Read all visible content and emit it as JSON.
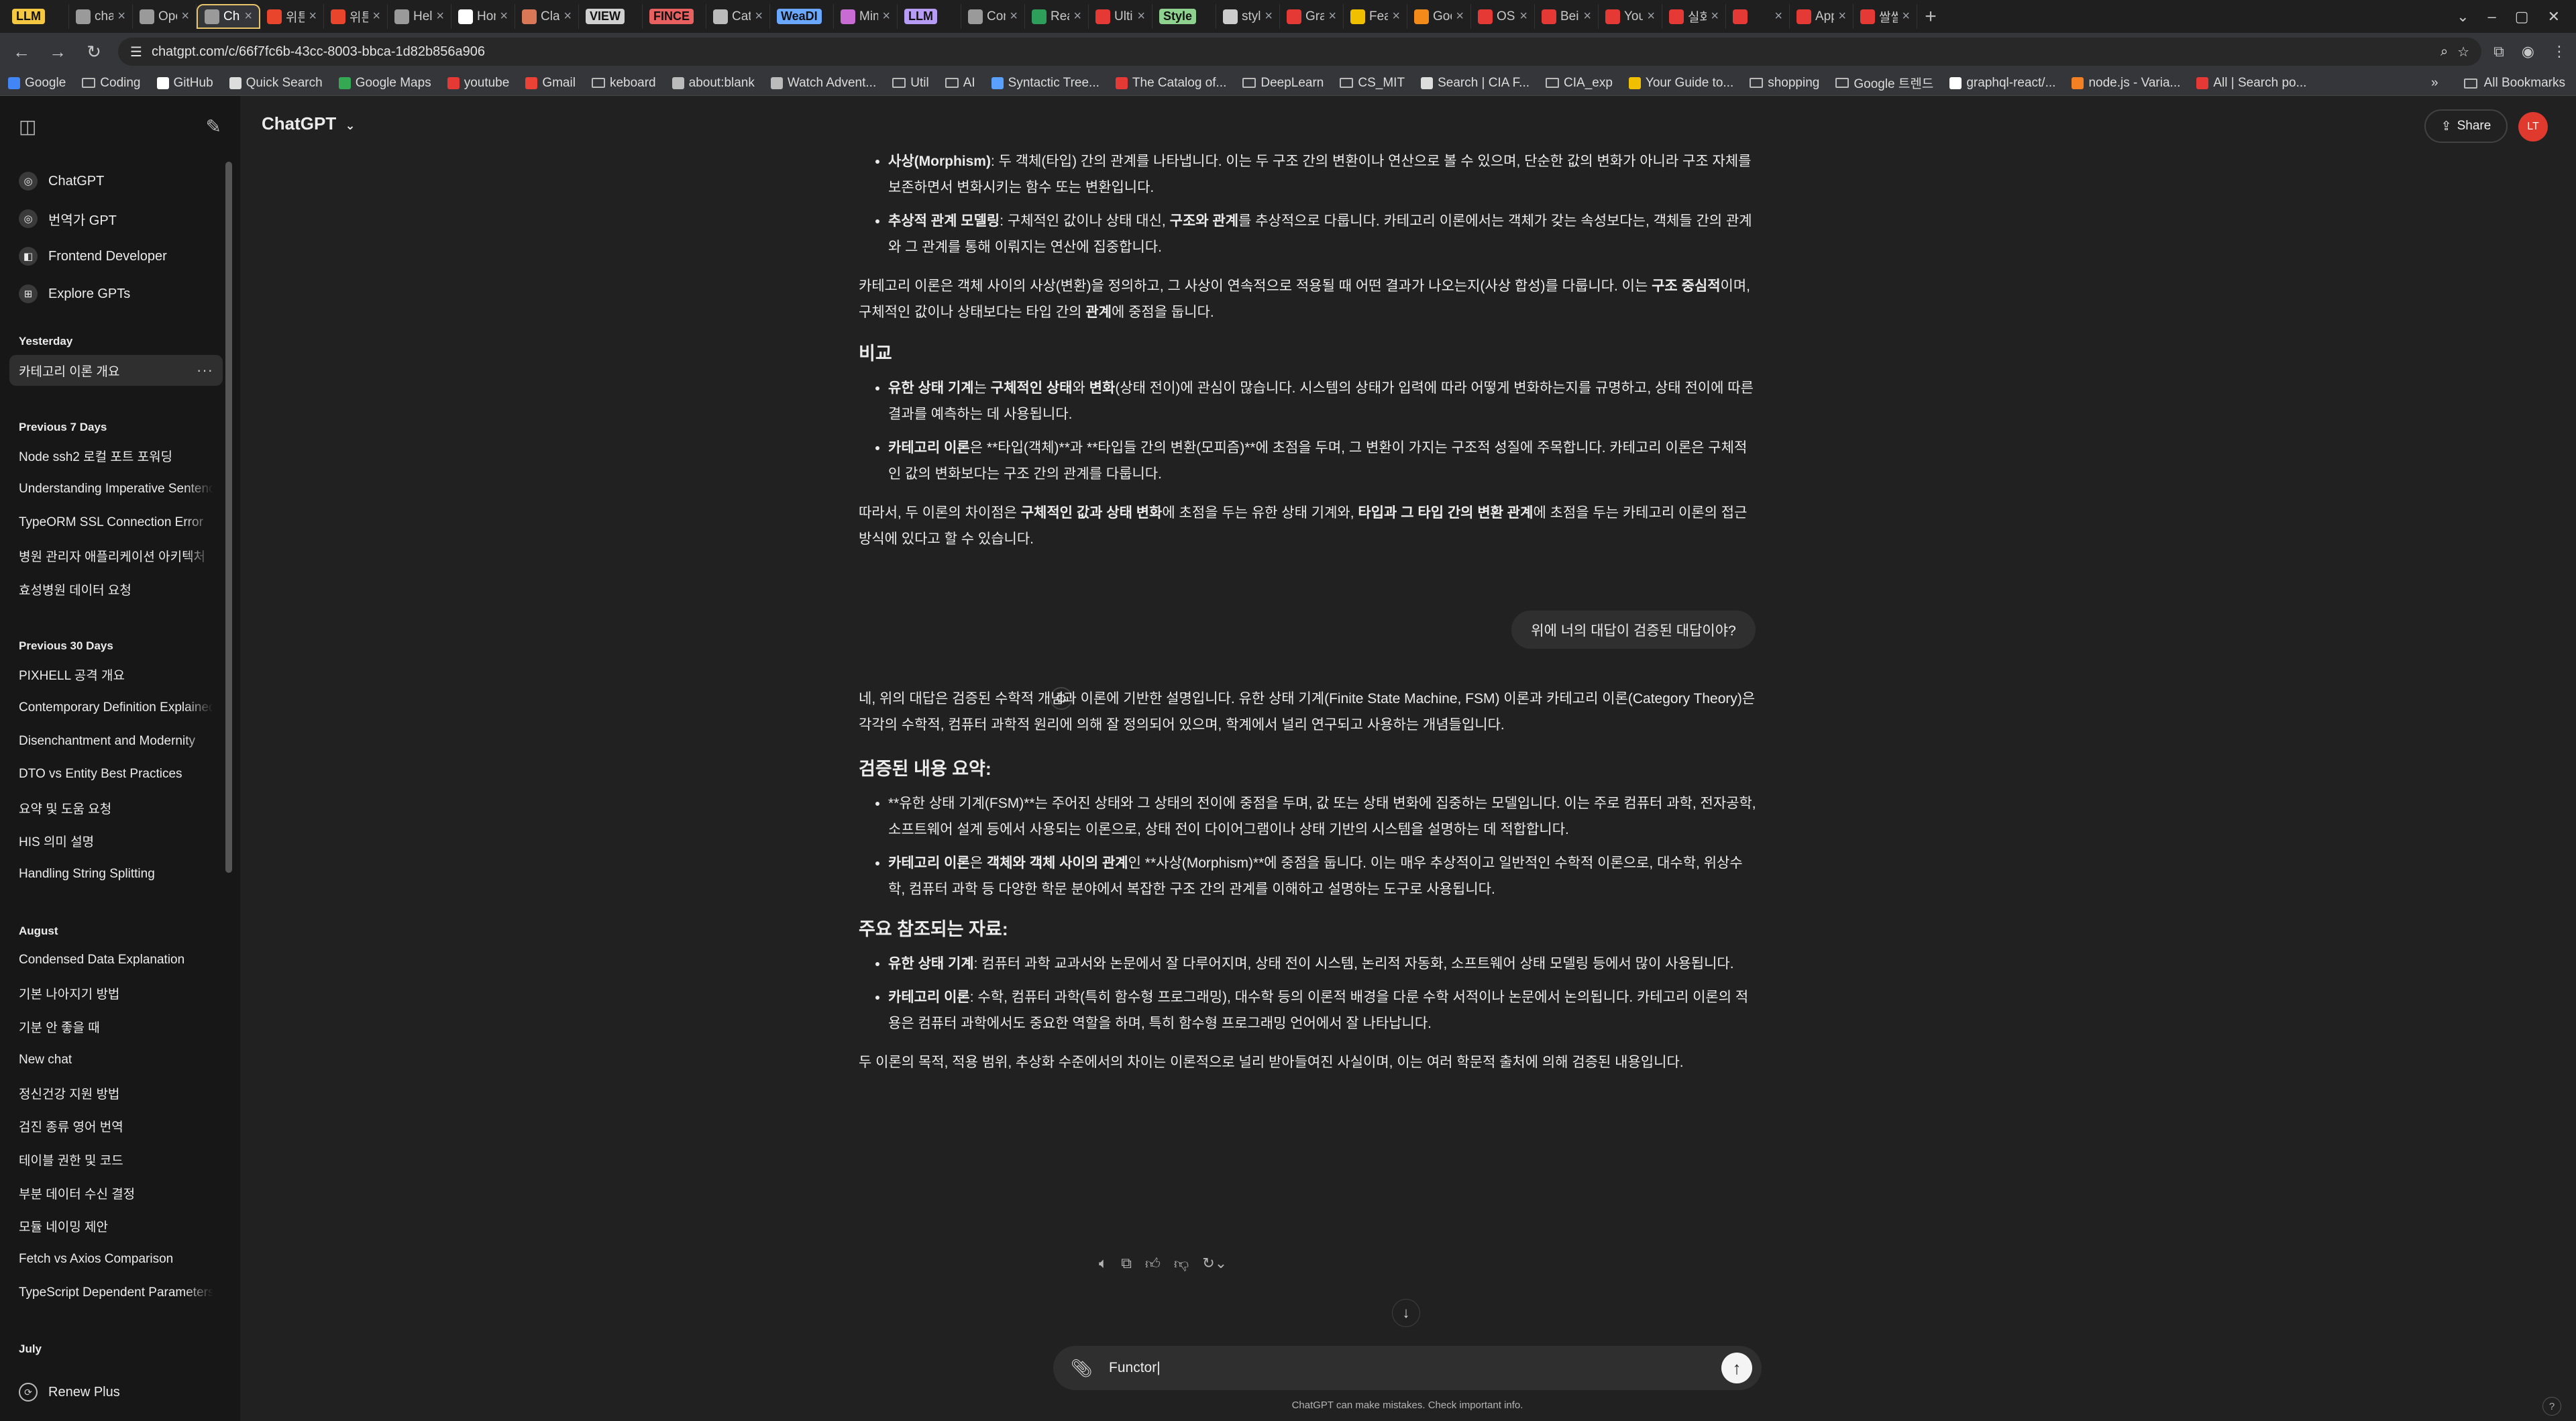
{
  "browser": {
    "tabs": [
      {
        "label": "LLM",
        "pill": true,
        "pill_color": "#f5c842",
        "favicon": "#f5c842"
      },
      {
        "label": "chatG",
        "favicon": "#9a9a9a"
      },
      {
        "label": "Open",
        "favicon": "#9a9a9a"
      },
      {
        "label": "Chat",
        "favicon": "#9a9a9a",
        "active": true
      },
      {
        "label": "위튼",
        "favicon": "#e8452c"
      },
      {
        "label": "위튼",
        "favicon": "#e8452c"
      },
      {
        "label": "Hello",
        "favicon": "#9a9a9a"
      },
      {
        "label": "Hom",
        "favicon": "#ffffff"
      },
      {
        "label": "Clau",
        "favicon": "#d97757"
      },
      {
        "label": "VIEW",
        "pill": true,
        "pill_color": "#d0d0d0",
        "favicon": ""
      },
      {
        "label": "FINCE",
        "pill": true,
        "pill_color": "#e86060",
        "favicon": ""
      },
      {
        "label": "Cate",
        "favicon": "#bbbbbb"
      },
      {
        "label": "WeaDI",
        "pill": true,
        "pill_color": "#6aa8ff",
        "favicon": ""
      },
      {
        "label": "Mim",
        "favicon": "#c86bd3"
      },
      {
        "label": "LLM",
        "pill": true,
        "pill_color": "#b79cf5",
        "favicon": ""
      },
      {
        "label": "Cont",
        "favicon": "#9a9a9a"
      },
      {
        "label": "Rea",
        "favicon": "#2e9e5b"
      },
      {
        "label": "Ultin",
        "favicon": "#e53935"
      },
      {
        "label": "Style",
        "pill": true,
        "pill_color": "#8fd18f",
        "favicon": ""
      },
      {
        "label": "style",
        "favicon": "#cccccc"
      },
      {
        "label": "Grap",
        "favicon": "#e53935"
      },
      {
        "label": "Feat",
        "favicon": "#f0c000"
      },
      {
        "label": "Goo",
        "favicon": "#f48a1a"
      },
      {
        "label": "OSI",
        "favicon": "#e53935"
      },
      {
        "label": "Bein",
        "favicon": "#e53935"
      },
      {
        "label": "YouT",
        "favicon": "#e53935"
      },
      {
        "label": "실화",
        "favicon": "#e53935"
      },
      {
        "label": "",
        "favicon": "#e53935"
      },
      {
        "label": "Appl",
        "favicon": "#e53935"
      },
      {
        "label": "쌀쌀",
        "favicon": "#e53935"
      }
    ],
    "new_tab": "+",
    "url": "chatgpt.com/c/66f7fc6b-43cc-8003-bbca-1d82b856a906",
    "bookmarks": [
      {
        "label": "Google",
        "icon": "google-icon",
        "color": "#4285f4"
      },
      {
        "label": "Coding",
        "icon": "folder-icon"
      },
      {
        "label": "GitHub",
        "icon": "github-icon",
        "color": "#ffffff"
      },
      {
        "label": "Quick Search",
        "icon": "bookmark-icon",
        "color": "#dddddd"
      },
      {
        "label": "Google Maps",
        "icon": "maps-icon",
        "color": "#34a853"
      },
      {
        "label": "youtube",
        "icon": "youtube-icon",
        "color": "#e53935"
      },
      {
        "label": "Gmail",
        "icon": "gmail-icon",
        "color": "#ea4335"
      },
      {
        "label": "keboard",
        "icon": "folder-icon"
      },
      {
        "label": "about:blank",
        "icon": "globe-icon",
        "color": "#bbbbbb"
      },
      {
        "label": "Watch Advent...",
        "icon": "globe-icon",
        "color": "#bbbbbb"
      },
      {
        "label": "Util",
        "icon": "folder-icon"
      },
      {
        "label": "AI",
        "icon": "folder-icon"
      },
      {
        "label": "Syntactic Tree...",
        "icon": "bookmark-icon",
        "color": "#5aa0ff"
      },
      {
        "label": "The Catalog of...",
        "icon": "bookmark-icon",
        "color": "#e53935"
      },
      {
        "label": "DeepLearn",
        "icon": "folder-icon"
      },
      {
        "label": "CS_MIT",
        "icon": "folder-icon"
      },
      {
        "label": "Search | CIA F...",
        "icon": "bookmark-icon",
        "color": "#dddddd"
      },
      {
        "label": "CIA_exp",
        "icon": "folder-icon"
      },
      {
        "label": "Your Guide to...",
        "icon": "bookmark-icon",
        "color": "#f0c000"
      },
      {
        "label": "shopping",
        "icon": "folder-icon"
      },
      {
        "label": "Google 트렌드",
        "icon": "folder-icon"
      },
      {
        "label": "graphql-react/...",
        "icon": "github-icon",
        "color": "#ffffff"
      },
      {
        "label": "node.js - Varia...",
        "icon": "bookmark-icon",
        "color": "#f48024"
      },
      {
        "label": "All | Search po...",
        "icon": "bookmark-icon",
        "color": "#e53935"
      }
    ],
    "more_bookmarks": "»",
    "all_bookmarks": "All Bookmarks"
  },
  "sidebar": {
    "gpts": [
      {
        "label": "ChatGPT",
        "icon": "chatgpt-icon"
      },
      {
        "label": "번역가 GPT",
        "icon": "gpt-icon"
      },
      {
        "label": "Frontend Developer",
        "icon": "frontend-gpt-icon"
      },
      {
        "label": "Explore GPTs",
        "icon": "grid-icon"
      }
    ],
    "sections": [
      {
        "heading": "Yesterday",
        "items": [
          "카테고리 이론 개요"
        ]
      },
      {
        "heading": "Previous 7 Days",
        "items": [
          "Node ssh2 로컬 포트 포워딩",
          "Understanding Imperative Sentences",
          "TypeORM SSL Connection Error",
          "병원 관리자 애플리케이션 아키텍처",
          "효성병원 데이터 요청"
        ]
      },
      {
        "heading": "Previous 30 Days",
        "items": [
          "PIXHELL 공격 개요",
          "Contemporary Definition Explained",
          "Disenchantment and Modernity",
          "DTO vs Entity Best Practices",
          "요약 및 도움 요청",
          "HIS 의미 설명",
          "Handling String Splitting"
        ]
      },
      {
        "heading": "August",
        "items": [
          "Condensed Data Explanation",
          "기본 나아지기 방법",
          "기분 안 좋을 때",
          "New chat",
          "정신건강 지원 방법",
          "검진 종류 영어 번역",
          "테이블 권한 및 코드",
          "부분 데이터 수신 결정",
          "모듈 네이밍 제안",
          "Fetch vs Axios Comparison",
          "TypeScript Dependent Parameters"
        ]
      },
      {
        "heading": "July",
        "items": []
      }
    ],
    "active_item_options": "···",
    "renew_label": "Renew Plus"
  },
  "header": {
    "model": "ChatGPT",
    "share": "Share",
    "avatar_initials": "LT",
    "avatar_color": "#e03a2f"
  },
  "chat": {
    "prev_answer": {
      "top_bullets": [
        {
          "bold": "사상(Morphism)",
          "text": ": 두 객체(타입) 간의 관계를 나타냅니다. 이는 두 구조 간의 변환이나 연산으로 볼 수 있으며, 단순한 값의 변화가 아니라 구조 자체를 보존하면서 변화시키는 함수 또는 변환입니다."
        },
        {
          "bold": "추상적 관계 모델링",
          "text": ": 구체적인 값이나 상태 대신, ",
          "bold2": "구조와 관계",
          "text2": "를 추상적으로 다룹니다. 카테고리 이론에서는 객체가 갖는 속성보다는, 객체들 간의 관계와 그 관계를 통해 이뤄지는 연산에 집중합니다."
        }
      ],
      "para1_a": "카테고리 이론은 객체 사이의 사상(변환)을 정의하고, 그 사상이 연속적으로 적용될 때 어떤 결과가 나오는지(사상 합성)를 다룹니다. 이는 ",
      "para1_b": "구조 중심적",
      "para1_c": "이며, 구체적인 값이나 상태보다는 타입 간의 ",
      "para1_d": "관계",
      "para1_e": "에 중점을 둡니다.",
      "compare_heading": "비교",
      "compare_1_b1": "유한 상태 기계",
      "compare_1_t1": "는 ",
      "compare_1_b2": "구체적인 상태",
      "compare_1_t2": "와 ",
      "compare_1_b3": "변화",
      "compare_1_t3": "(상태 전이)에 관심이 많습니다. 시스템의 상태가 입력에 따라 어떻게 변화하는지를 규명하고, 상태 전이에 따른 결과를 예측하는 데 사용됩니다.",
      "compare_2_b1": "카테고리 이론",
      "compare_2_t1": "은 **타입(객체)**과 **타입들 간의 변환(모피즘)**에 초점을 두며, 그 변환이 가지는 구조적 성질에 주목합니다. 카테고리 이론은 구체적인 값의 변화보다는 구조 간의 관계를 다룹니다.",
      "conclusion_a": "따라서, 두 이론의 차이점은 ",
      "conclusion_b": "구체적인 값과 상태 변화",
      "conclusion_c": "에 초점을 두는 유한 상태 기계와, ",
      "conclusion_d": "타입과 그 타입 간의 변환 관계",
      "conclusion_e": "에 초점을 두는 카테고리 이론의 접근 방식에 있다고 할 수 있습니다."
    },
    "user_message": "위에 너의 대답이 검증된 대답이야?",
    "answer": {
      "intro": "네, 위의 대답은 검증된 수학적 개념과 이론에 기반한 설명입니다. 유한 상태 기계(Finite State Machine, FSM) 이론과 카테고리 이론(Category Theory)은 각각의 수학적, 컴퓨터 과학적 원리에 의해 잘 정의되어 있으며, 학계에서 널리 연구되고 사용하는 개념들입니다.",
      "h_summary": "검증된 내용 요약:",
      "summary_1": "**유한 상태 기계(FSM)**는 주어진 상태와 그 상태의 전이에 중점을 두며, 값 또는 상태 변화에 집중하는 모델입니다. 이는 주로 컴퓨터 과학, 전자공학, 소프트웨어 설계 등에서 사용되는 이론으로, 상태 전이 다이어그램이나 상태 기반의 시스템을 설명하는 데 적합합니다.",
      "summary_2_b1": "카테고리 이론",
      "summary_2_t1": "은 ",
      "summary_2_b2": "객체와 객체 사이의 관계",
      "summary_2_t2": "인 **사상(Morphism)**에 중점을 둡니다. 이는 매우 추상적이고 일반적인 수학적 이론으로, 대수학, 위상수학, 컴퓨터 과학 등 다양한 학문 분야에서 복잡한 구조 간의 관계를 이해하고 설명하는 도구로 사용됩니다.",
      "h_refs": "주요 참조되는 자료:",
      "ref_1_b": "유한 상태 기계",
      "ref_1_t": ": 컴퓨터 과학 교과서와 논문에서 잘 다루어지며, 상태 전이 시스템, 논리적 자동화, 소프트웨어 상태 모델링 등에서 많이 사용됩니다.",
      "ref_2_b": "카테고리 이론",
      "ref_2_t": ": 수학, 컴퓨터 과학(특히 함수형 프로그래밍), 대수학 등의 이론적 배경을 다룬 수학 서적이나 논문에서 논의됩니다. 카테고리 이론의 적용은 컴퓨터 과학에서도 중요한 역할을 하며, 특히 함수형 프로그래밍 언어에서 잘 나타납니다.",
      "closing": "두 이론의 목적, 적용 범위, 추상화 수준에서의 차이는 이론적으로 널리 받아들여진 사실이며, 이는 여러 학문적 출처에 의해 검증된 내용입니다."
    },
    "action_icons": [
      "speaker-icon",
      "copy-icon",
      "thumbs-up-icon",
      "thumbs-down-icon",
      "regenerate-icon"
    ]
  },
  "composer": {
    "value": "Functor",
    "disclaimer": "ChatGPT can make mistakes. Check important info.",
    "help": "?"
  }
}
